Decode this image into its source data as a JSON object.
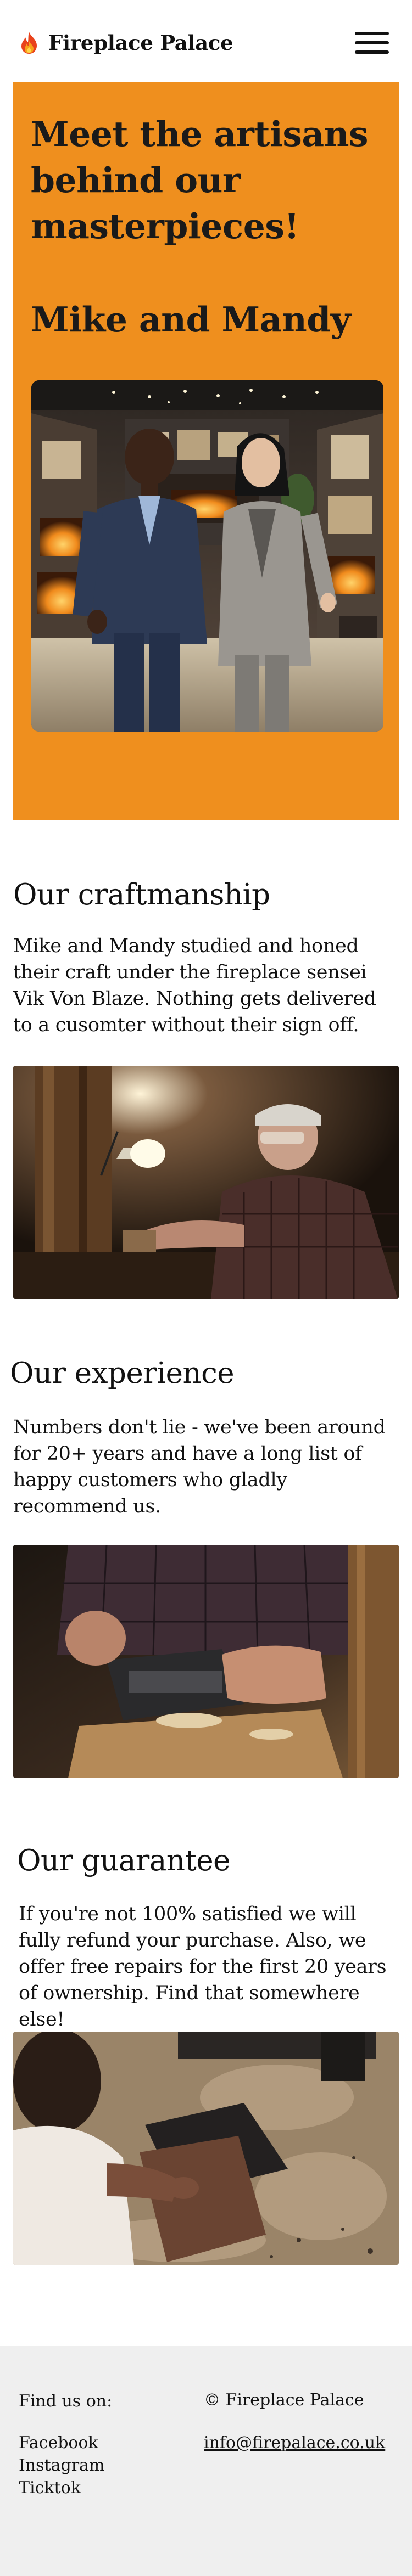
{
  "header": {
    "brand_name": "Fireplace Palace",
    "logo_icon": "flame-icon",
    "menu_icon": "hamburger-menu-icon"
  },
  "colors": {
    "hero_background": "#ef8f1e",
    "footer_background": "#efefef",
    "text": "#111111"
  },
  "hero": {
    "heading": "Meet the artisans behind our masterpieces!",
    "subheading": "Mike and Mandy",
    "photo": "photo of Mike and Mandy standing in a fireplace showroom"
  },
  "sections": [
    {
      "title": "Our craftmanship",
      "body": "Mike and Mandy studied and honed their craft under the fireplace sensei Vik Von Blaze. Nothing gets delivered to a cusomter without their sign off.",
      "photo": "photo of an older craftsman working at a bench"
    },
    {
      "title": "Our experience",
      "body": "Numbers don't lie - we've been around for 20+ years and have a long list of happy customers who gladly recommend us.",
      "photo": "photo of hands planing a piece of wood"
    },
    {
      "title": "Our guarantee",
      "body": "If you're not 100% satisfied we will fully refund your purchase. Also, we offer free repairs for the first 20 years of ownership. Find that somewhere else!",
      "photo": "photo of a worker sanding a board in a dusty workshop"
    }
  ],
  "footer": {
    "find_us_label": "Find us on:",
    "social_links": [
      "Facebook",
      "Instagram",
      "Ticktok"
    ],
    "copyright": "© Fireplace Palace",
    "email": "info@firepalace.co.uk"
  }
}
